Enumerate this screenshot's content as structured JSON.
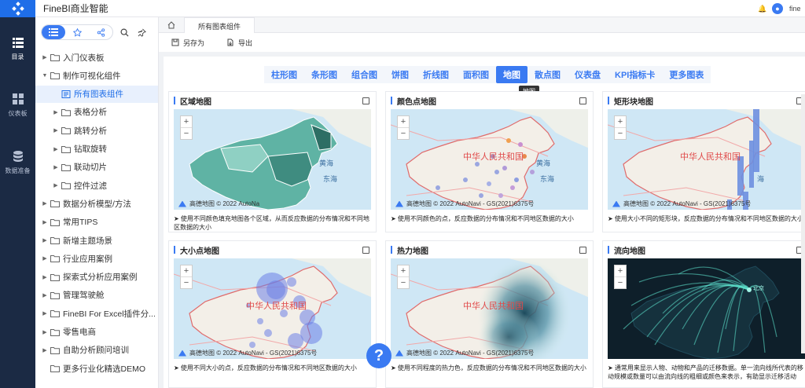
{
  "app": {
    "title": "FineBI商业智能",
    "user": "fineb"
  },
  "rail": [
    {
      "label": "目录",
      "icon": "catalog-icon",
      "active": true
    },
    {
      "label": "仪表板",
      "icon": "dashboard-icon",
      "active": false
    },
    {
      "label": "数据准备",
      "icon": "database-icon",
      "active": false
    }
  ],
  "tree": [
    {
      "label": "入门仪表板",
      "level": 0,
      "state": "collapsed"
    },
    {
      "label": "制作可视化组件",
      "level": 0,
      "state": "expanded"
    },
    {
      "label": "所有图表组件",
      "level": 1,
      "state": "leaf",
      "selected": true
    },
    {
      "label": "表格分析",
      "level": 1,
      "state": "collapsed"
    },
    {
      "label": "跳转分析",
      "level": 1,
      "state": "collapsed"
    },
    {
      "label": "钻取旋转",
      "level": 1,
      "state": "collapsed"
    },
    {
      "label": "联动切片",
      "level": 1,
      "state": "collapsed"
    },
    {
      "label": "控件过滤",
      "level": 1,
      "state": "collapsed"
    },
    {
      "label": "数据分析模型/方法",
      "level": 0,
      "state": "collapsed"
    },
    {
      "label": "常用TIPS",
      "level": 0,
      "state": "collapsed"
    },
    {
      "label": "新增主题场景",
      "level": 0,
      "state": "collapsed"
    },
    {
      "label": "行业应用案例",
      "level": 0,
      "state": "collapsed"
    },
    {
      "label": "探索式分析应用案例",
      "level": 0,
      "state": "collapsed"
    },
    {
      "label": "管理驾驶舱",
      "level": 0,
      "state": "collapsed"
    },
    {
      "label": "FineBI For Excel插件分...",
      "level": 0,
      "state": "collapsed"
    },
    {
      "label": "零售电商",
      "level": 0,
      "state": "collapsed"
    },
    {
      "label": "自助分析顾问培训",
      "level": 0,
      "state": "collapsed"
    },
    {
      "label": "更多行业化精选DEMO",
      "level": 0,
      "state": "leaf"
    }
  ],
  "tabs": {
    "active": "所有图表组件"
  },
  "toolbar": {
    "save_as": "另存为",
    "export": "导出"
  },
  "categories": [
    "柱形图",
    "条形图",
    "组合图",
    "饼图",
    "折线图",
    "面积图",
    "地图",
    "散点图",
    "仪表盘",
    "KPI指标卡",
    "更多图表"
  ],
  "active_category": "地图",
  "tooltip": "地图",
  "cards": [
    {
      "title": "区域地图",
      "desc": "➤ 使用不同颜色填充地图各个区域，从而反应数据的分布情况和不同地区数据的大小",
      "credit": "高德地图  © 2022 AutoNa",
      "map_label": "",
      "sea1": "黄海",
      "sea2": "东海"
    },
    {
      "title": "颜色点地图",
      "desc": "➤ 使用不同颜色的点，反应数据的分布情况和不同地区数据的大小",
      "credit": "高德地图  © 2022 AutoNavi - GS(2021)6375号",
      "map_label": "中华人民共和国",
      "sea1": "黄海",
      "sea2": "东海"
    },
    {
      "title": "矩形块地图",
      "desc": "➤ 使用大小不同的矩形块，反应数据的分布情况和不同地区数据的大小",
      "credit": "高德地图  © 2022 AutoNavi - GS(2021)6375号",
      "map_label": "中华人民共和国",
      "sea1": "",
      "sea2": "海"
    },
    {
      "title": "大小点地图",
      "desc": "➤ 使用不同大小的点，反应数据的分布情况和不同地区数据的大小",
      "credit": "高德地图  © 2022 AutoNavi - GS(2021)6375号",
      "map_label": "中华人民共和国",
      "sea1": "",
      "sea2": ""
    },
    {
      "title": "热力地图",
      "desc": "➤ 使用不同程度的热力色，反应数据的分布情况和不同地区数据的大小",
      "credit": "高德地图  © 2022 AutoNavi - GS(2021)6375号",
      "map_label": "中华人民共和国",
      "sea1": "",
      "sea2": ""
    },
    {
      "title": "流向地图",
      "desc": "➤ 通常用来显示人物、动物和产品的迁移数据。单一流向线所代表的移动规模或数量可以由流向线的粗细或颜色来表示，有助显示迁移活动",
      "credit": "",
      "map_label": "",
      "sea1": "",
      "sea2": "",
      "city": "北京"
    }
  ],
  "help": "?",
  "colors": {
    "primary": "#3a7af2",
    "rail": "#1b2a44",
    "region_fill": "#5fb3a4"
  }
}
